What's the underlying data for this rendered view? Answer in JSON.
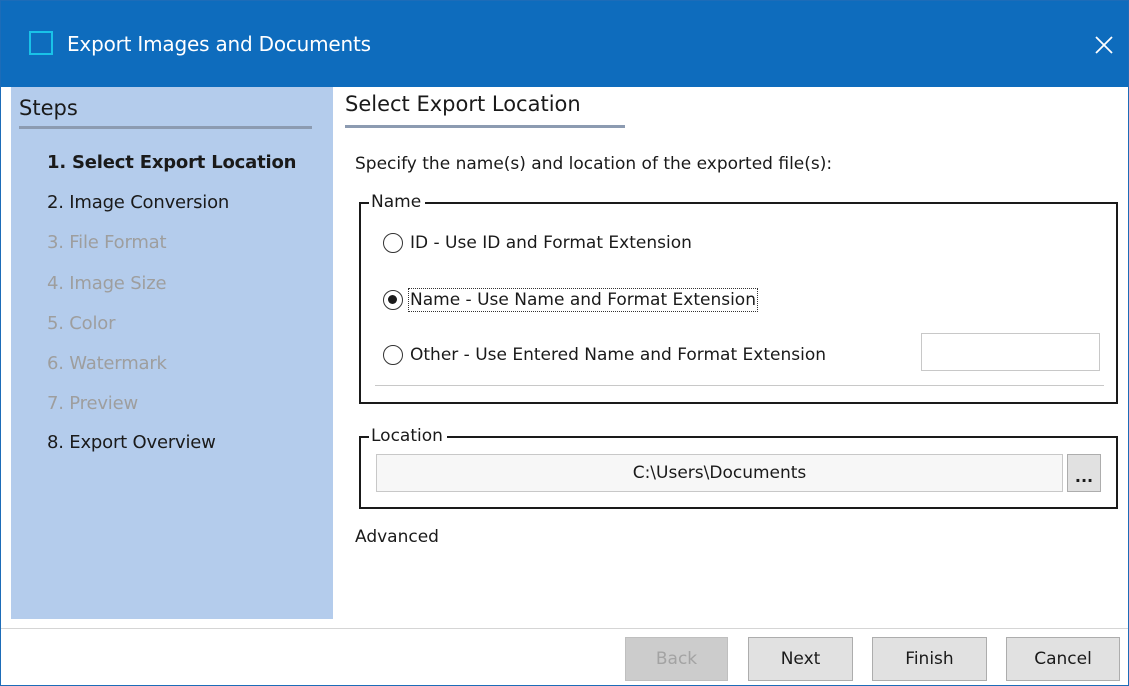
{
  "window": {
    "title": "Export Images and Documents",
    "titlebar_color": "#0e6cbd",
    "close_icon": "close-icon",
    "app_icon": "window-icon"
  },
  "sidebar": {
    "heading": "Steps",
    "background_color": "#b4ccec",
    "steps": [
      {
        "label": "1. Select Export Location",
        "state": "current"
      },
      {
        "label": "2. Image Conversion",
        "state": "enabled"
      },
      {
        "label": "3. File Format",
        "state": "disabled"
      },
      {
        "label": "4. Image Size",
        "state": "disabled"
      },
      {
        "label": "5. Color",
        "state": "disabled"
      },
      {
        "label": "6. Watermark",
        "state": "disabled"
      },
      {
        "label": "7. Preview",
        "state": "disabled"
      },
      {
        "label": "8. Export Overview",
        "state": "enabled"
      }
    ]
  },
  "main": {
    "title": "Select Export Location",
    "instruction": "Specify the name(s) and location of the exported file(s):",
    "name_group": {
      "legend": "Name",
      "options": [
        {
          "label": "ID - Use ID and Format Extension",
          "checked": false
        },
        {
          "label": "Name - Use Name and Format Extension",
          "checked": true
        },
        {
          "label": "Other - Use Entered Name and Format Extension",
          "checked": false
        }
      ],
      "other_value": ""
    },
    "location_group": {
      "legend": "Location",
      "path": "C:\\Users\\Documents",
      "browse_label": "..."
    },
    "advanced_label": "Advanced"
  },
  "footer": {
    "back_label": "Back",
    "back_enabled": false,
    "next_label": "Next",
    "finish_label": "Finish",
    "cancel_label": "Cancel"
  }
}
